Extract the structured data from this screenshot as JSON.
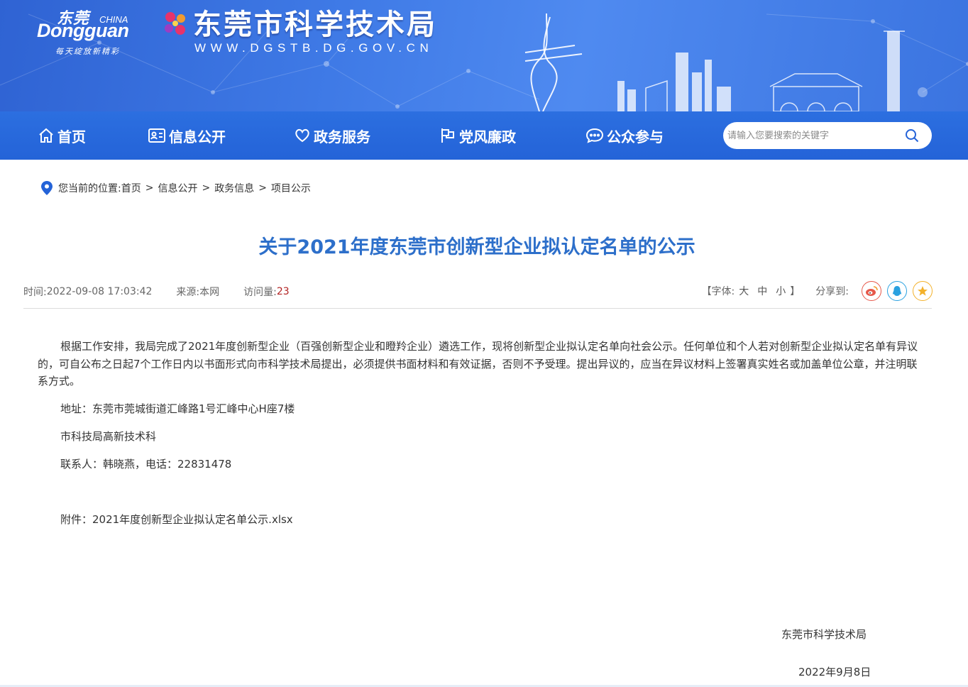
{
  "header": {
    "logo": {
      "cn": "东莞",
      "china": "CHINA",
      "en": "Dongguan",
      "slogan": "每天绽放新精彩"
    },
    "site_title": "东莞市科学技术局",
    "site_url": "WWW.DGSTB.DG.GOV.CN"
  },
  "nav": {
    "items": [
      {
        "label": "首页",
        "icon": "home-icon"
      },
      {
        "label": "信息公开",
        "icon": "id-card-icon"
      },
      {
        "label": "政务服务",
        "icon": "heart-icon"
      },
      {
        "label": "党风廉政",
        "icon": "flag-icon"
      },
      {
        "label": "公众参与",
        "icon": "chat-icon"
      }
    ],
    "search": {
      "placeholder": "请输入您要搜索的关键字",
      "icon": "search-icon"
    }
  },
  "breadcrumb": {
    "label": "您当前的位置:",
    "items": [
      "首页",
      "信息公开",
      "政务信息",
      "项目公示"
    ],
    "separator": ">"
  },
  "article": {
    "title": "关于2021年度东莞市创新型企业拟认定名单的公示",
    "meta": {
      "time_label": "时间:",
      "time": "2022-09-08 17:03:42",
      "source_label": "来源:",
      "source": "本网",
      "views_label": "访问量:",
      "views": "23"
    },
    "font_size": {
      "open": "【字体:",
      "large": "大",
      "medium": "中",
      "small": "小",
      "close": "】"
    },
    "share": {
      "label": "分享到:",
      "targets": [
        {
          "name": "weibo-icon",
          "color": "#e6584a"
        },
        {
          "name": "qq-icon",
          "color": "#2aa1e0"
        },
        {
          "name": "qzone-icon",
          "color": "#f3b12b"
        }
      ]
    },
    "body": {
      "paragraph": "根据工作安排，我局完成了2021年度创新型企业（百强创新型企业和瞪羚企业）遴选工作，现将创新型企业拟认定名单向社会公示。任何单位和个人若对创新型企业拟认定名单有异议的，可自公布之日起7个工作日内以书面形式向市科学技术局提出，必须提供书面材料和有效证据，否则不予受理。提出异议的，应当在异议材料上签署真实姓名或加盖单位公章，并注明联系方式。",
      "address": "地址：东莞市莞城街道汇峰路1号汇峰中心H座7楼",
      "department": "市科技局高新技术科",
      "contact": "联系人：韩晓燕，电话：22831478",
      "attachment": "附件：2021年度创新型企业拟认定名单公示.xlsx"
    },
    "signature": {
      "org": "东莞市科学技术局",
      "date": "2022年9月8日"
    }
  },
  "colors": {
    "banner": "#3b74e0",
    "nav": "#2463d8",
    "title": "#2d6fca",
    "views": "#b22222"
  }
}
